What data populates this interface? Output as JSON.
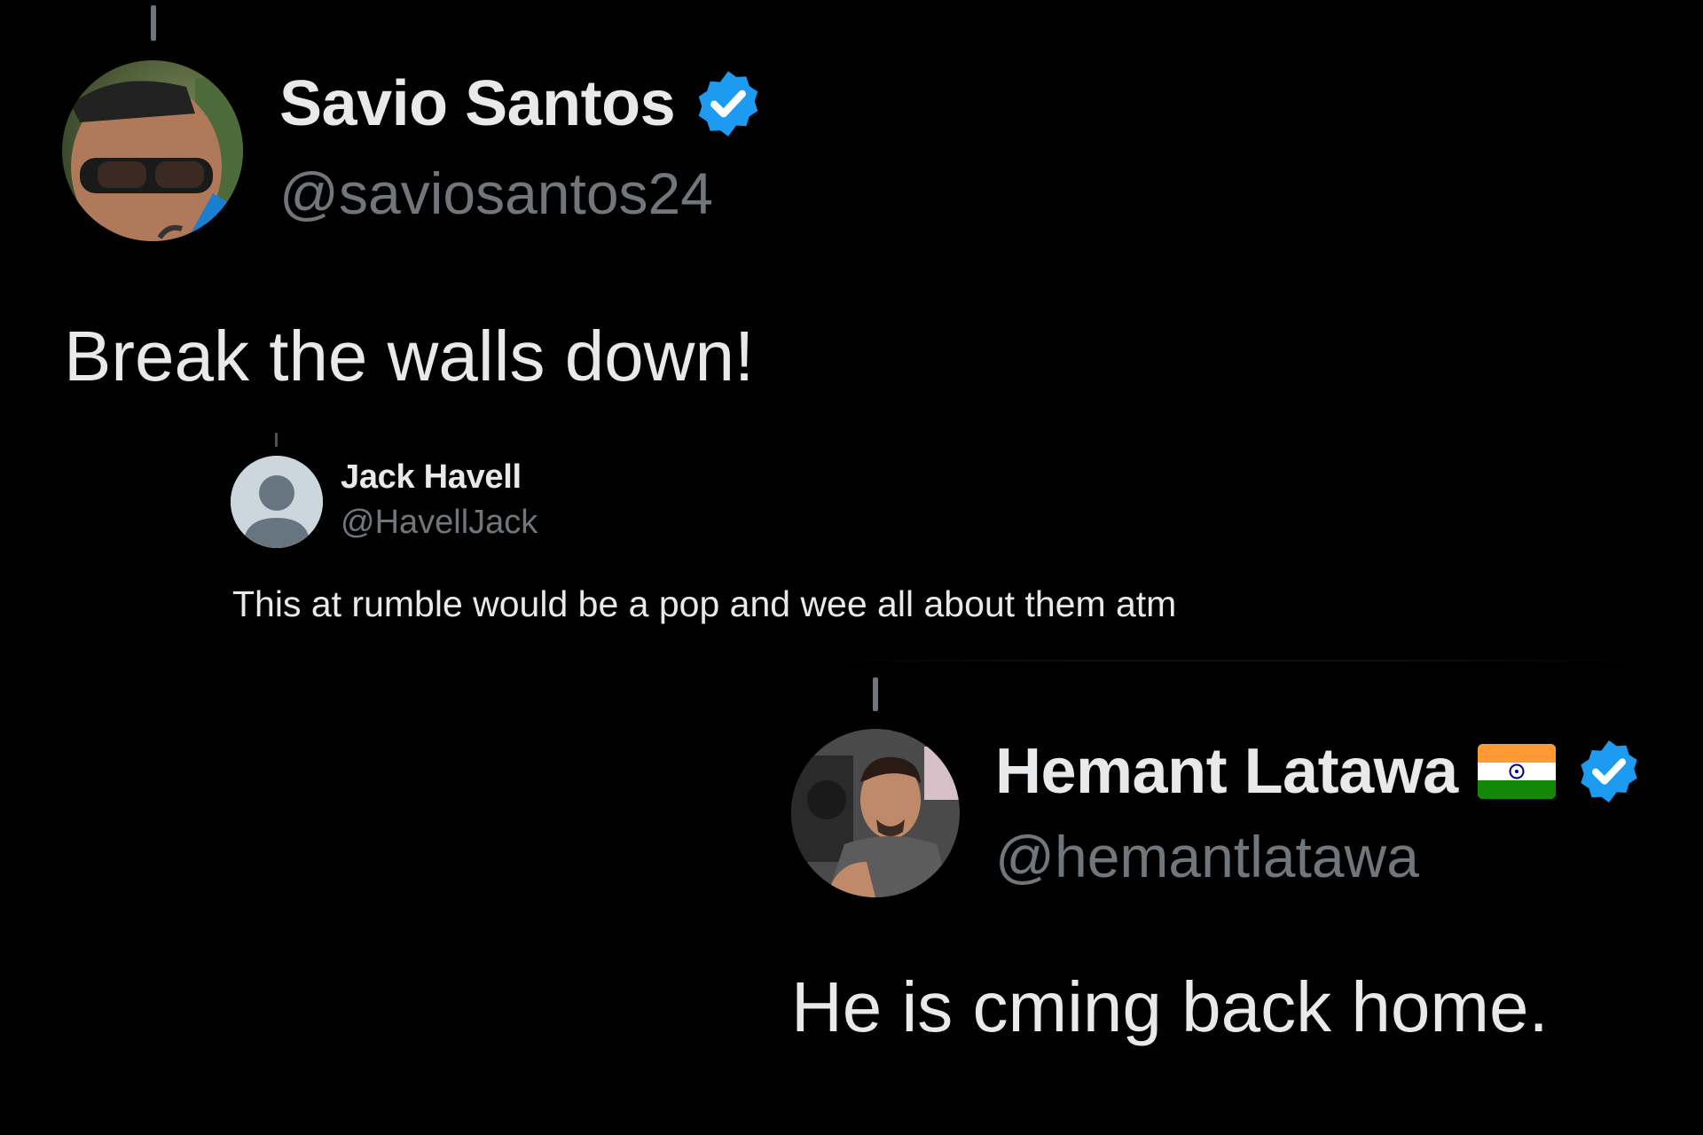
{
  "tweets": [
    {
      "display_name": "Savio Santos",
      "handle": "@saviosantos24",
      "verified": true,
      "text": "Break the walls down!",
      "avatar_icon": "profile-photo-sunglasses"
    },
    {
      "display_name": "Jack Havell",
      "handle": "@HavellJack",
      "verified": false,
      "text": "This at rumble would be a pop and wee all about them atm",
      "avatar_icon": "default-profile-icon"
    },
    {
      "display_name": "Hemant Latawa",
      "handle": "@hemantlatawa",
      "verified": true,
      "flag_icon": "india-flag-icon",
      "text": "He is cming back home.",
      "avatar_icon": "profile-photo-man"
    }
  ],
  "colors": {
    "background": "#000000",
    "text_primary": "#e7e9ea",
    "text_secondary": "#71767b",
    "verified_blue": "#1d9bf0"
  }
}
